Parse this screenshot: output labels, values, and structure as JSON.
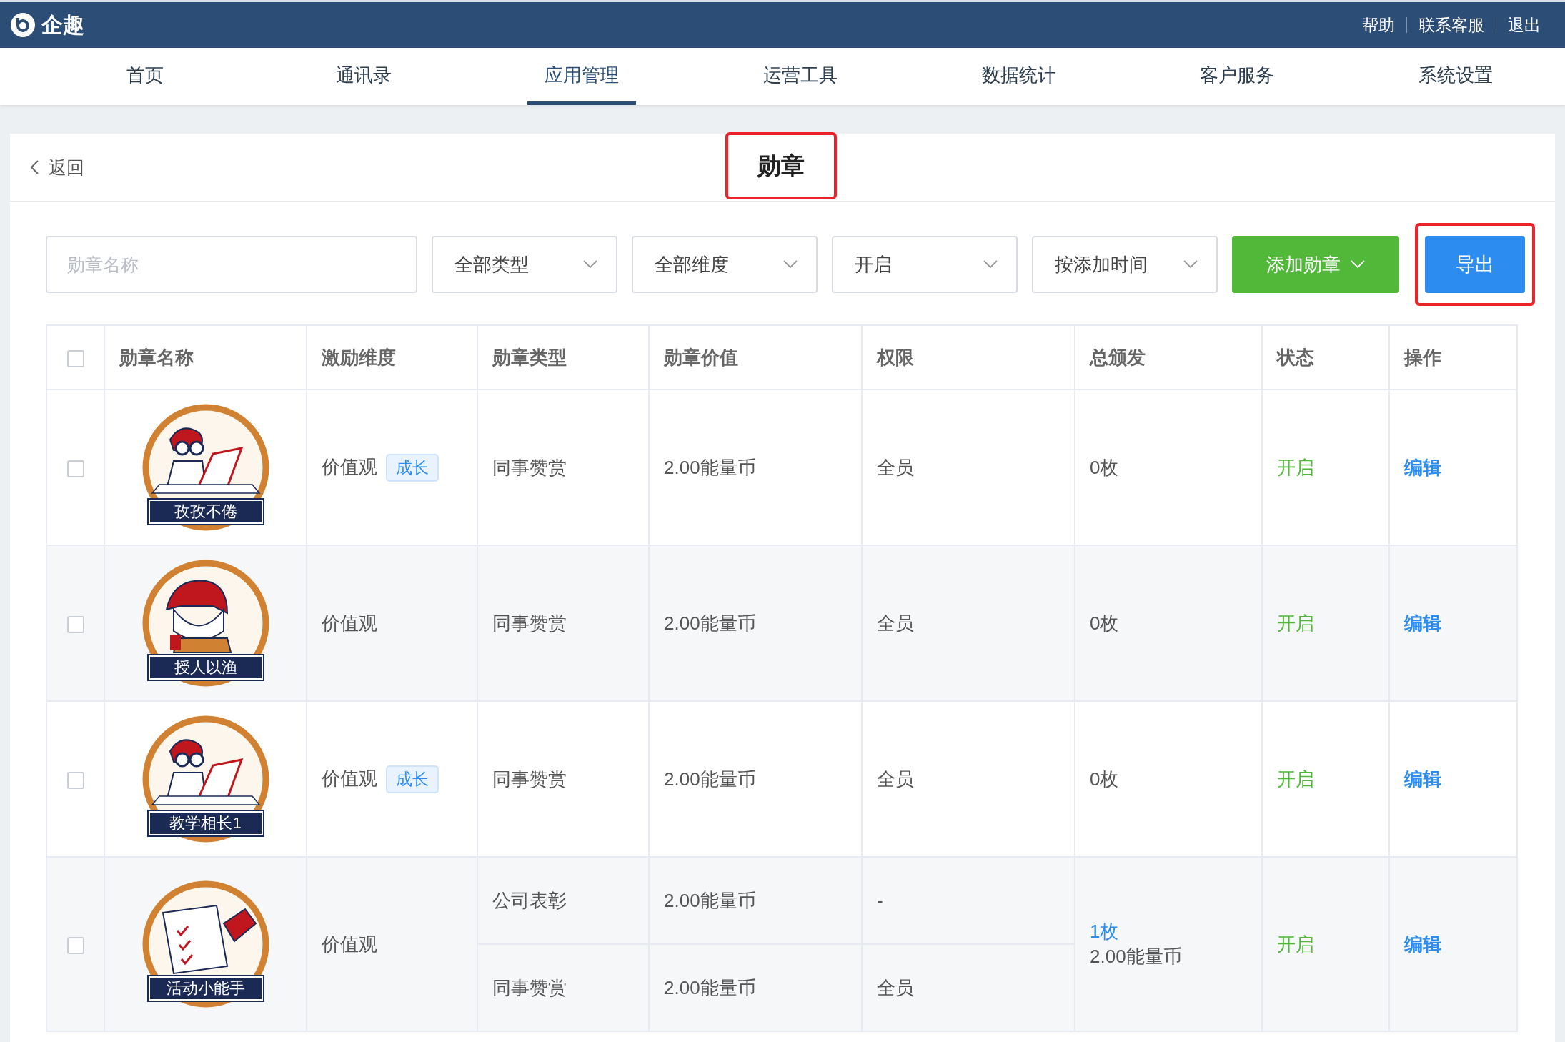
{
  "topbar": {
    "brand": "企趣",
    "links": [
      "帮助",
      "联系客服",
      "退出"
    ]
  },
  "nav": [
    {
      "label": "首页",
      "selected": false
    },
    {
      "label": "通讯录",
      "selected": false
    },
    {
      "label": "应用管理",
      "selected": true
    },
    {
      "label": "运营工具",
      "selected": false
    },
    {
      "label": "数据统计",
      "selected": false
    },
    {
      "label": "客户服务",
      "selected": false
    },
    {
      "label": "系统设置",
      "selected": false
    }
  ],
  "header": {
    "back": "返回",
    "title": "勋章"
  },
  "filters": {
    "search": {
      "placeholder": "勋章名称"
    },
    "selects": [
      "全部类型",
      "全部维度",
      "开启",
      "按添加时间"
    ],
    "add_button": "添加勋章",
    "export_button": "导出"
  },
  "table": {
    "select_all_checked": false,
    "columns": [
      "勋章名称",
      "激励维度",
      "勋章类型",
      "勋章价值",
      "权限",
      "总颁发",
      "状态",
      "操作"
    ],
    "rows": [
      {
        "checked": false,
        "badge": {
          "kind": "laptop",
          "caption": "孜孜不倦"
        },
        "dimension": "价值观",
        "tag": "成长",
        "entries": [
          {
            "type": "同事赞赏",
            "value": "2.00能量币",
            "permission": "全员"
          }
        ],
        "total": "0枚",
        "total_link": false,
        "status": "开启",
        "action": "编辑"
      },
      {
        "checked": false,
        "badge": {
          "kind": "teacher",
          "caption": "授人以渔"
        },
        "dimension": "价值观",
        "entries": [
          {
            "type": "同事赞赏",
            "value": "2.00能量币",
            "permission": "全员"
          }
        ],
        "total": "0枚",
        "total_link": false,
        "status": "开启",
        "action": "编辑"
      },
      {
        "checked": false,
        "badge": {
          "kind": "laptop",
          "caption": "教学相长1"
        },
        "dimension": "价值观",
        "tag": "成长",
        "entries": [
          {
            "type": "同事赞赏",
            "value": "2.00能量币",
            "permission": "全员"
          }
        ],
        "total": "0枚",
        "total_link": false,
        "status": "开启",
        "action": "编辑"
      },
      {
        "checked": false,
        "badge": {
          "kind": "checklist",
          "caption": "活动小能手"
        },
        "dimension": "价值观",
        "entries": [
          {
            "type": "公司表彰",
            "value": "2.00能量币",
            "permission": "-"
          },
          {
            "type": "同事赞赏",
            "value": "2.00能量币",
            "permission": "全员"
          }
        ],
        "total": "1枚",
        "total_link": true,
        "total_sub": "2.00能量币",
        "status": "开启",
        "action": "编辑"
      }
    ]
  }
}
